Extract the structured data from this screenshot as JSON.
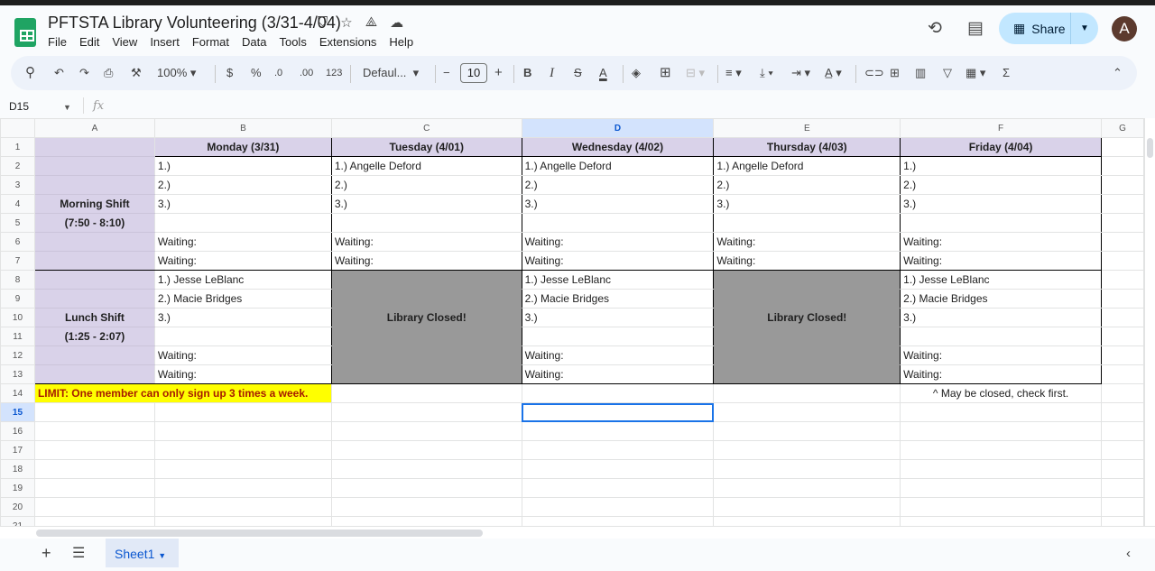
{
  "doc": {
    "title": "PFTSTA Library Volunteering (3/31-4/04)",
    "menu": [
      "File",
      "Edit",
      "View",
      "Insert",
      "Format",
      "Data",
      "Tools",
      "Extensions",
      "Help"
    ]
  },
  "header": {
    "share_label": "Share",
    "avatar_letter": "A"
  },
  "toolbar": {
    "zoom": "100%",
    "currency": "$",
    "percent": "%",
    "dec_less": ".0",
    "dec_more": ".00",
    "number_format": "123",
    "font": "Defaul...",
    "font_size": "10"
  },
  "formula_bar": {
    "name_box": "D15",
    "fx": "fx",
    "value": ""
  },
  "columns": [
    "A",
    "B",
    "C",
    "D",
    "E",
    "F",
    "G"
  ],
  "selected_cell": "D15",
  "rows": [
    [
      "",
      "Monday (3/31)",
      "Tuesday (4/01)",
      "Wednesday (4/02)",
      "Thursday (4/03)",
      "Friday (4/04)",
      ""
    ],
    [
      "",
      "1.)",
      "1.) Angelle Deford",
      "1.) Angelle Deford",
      "1.) Angelle Deford",
      "1.)",
      ""
    ],
    [
      "",
      "2.)",
      "2.)",
      "2.)",
      "2.)",
      "2.)",
      ""
    ],
    [
      "Morning Shift",
      "3.)",
      "3.)",
      "3.)",
      "3.)",
      "3.)",
      ""
    ],
    [
      "(7:50 - 8:10)",
      "",
      "",
      "",
      "",
      "",
      ""
    ],
    [
      "",
      "Waiting:",
      "Waiting:",
      "Waiting:",
      "Waiting:",
      "Waiting:",
      ""
    ],
    [
      "",
      "Waiting:",
      "Waiting:",
      "Waiting:",
      "Waiting:",
      "Waiting:",
      ""
    ],
    [
      "",
      "1.) Jesse LeBlanc",
      "",
      "1.) Jesse LeBlanc",
      "",
      "1.) Jesse LeBlanc",
      ""
    ],
    [
      "",
      "2.) Macie Bridges",
      "",
      "2.) Macie Bridges",
      "",
      "2.) Macie Bridges",
      ""
    ],
    [
      "Lunch Shift",
      "3.)",
      "Library Closed!",
      "3.)",
      "Library Closed!",
      "3.)",
      ""
    ],
    [
      "(1:25 - 2:07)",
      "",
      "",
      "",
      "",
      "",
      ""
    ],
    [
      "",
      "Waiting:",
      "",
      "Waiting:",
      "",
      "Waiting:",
      ""
    ],
    [
      "",
      "Waiting:",
      "",
      "Waiting:",
      "",
      "Waiting:",
      ""
    ],
    [
      "LIMIT: One member can only sign up 3 times a week.",
      "",
      "",
      "",
      "",
      "^ May be closed, check first.",
      ""
    ],
    [
      "",
      "",
      "",
      "",
      "",
      "",
      ""
    ],
    [
      "",
      "",
      "",
      "",
      "",
      "",
      ""
    ],
    [
      "",
      "",
      "",
      "",
      "",
      "",
      ""
    ],
    [
      "",
      "",
      "",
      "",
      "",
      "",
      ""
    ],
    [
      "",
      "",
      "",
      "",
      "",
      "",
      ""
    ],
    [
      "",
      "",
      "",
      "",
      "",
      "",
      ""
    ],
    [
      "",
      "",
      "",
      "",
      "",
      "",
      ""
    ],
    [
      "",
      "",
      "",
      "",
      "",
      "",
      ""
    ],
    [
      "",
      "",
      "",
      "",
      "",
      "",
      ""
    ]
  ],
  "sheets": [
    {
      "name": "Sheet1",
      "active": true
    }
  ],
  "colors": {
    "header_fill": "#d9d2e9",
    "closed_fill": "#999999",
    "limit_fill": "#ffff00",
    "limit_text": "#a61c00",
    "selection": "#1a73e8"
  }
}
